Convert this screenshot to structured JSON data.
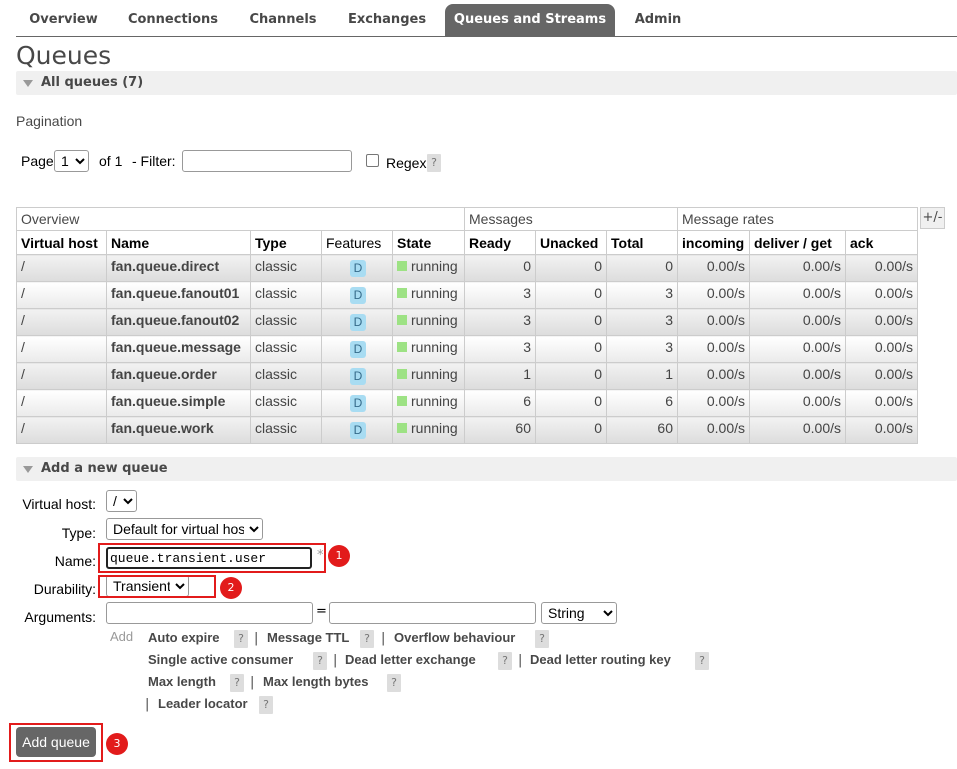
{
  "nav": {
    "tabs": [
      {
        "label": "Overview"
      },
      {
        "label": "Connections"
      },
      {
        "label": "Channels"
      },
      {
        "label": "Exchanges"
      },
      {
        "label": "Queues and Streams"
      },
      {
        "label": "Admin"
      }
    ],
    "active": "Queues and Streams"
  },
  "page_title": "Queues",
  "all_queues": {
    "header": "All queues (7)",
    "pagination_label": "Pagination",
    "page_label": "Page",
    "page_value": "1",
    "of_label": "of 1",
    "filter_label": "- Filter:",
    "filter_value": "",
    "regex_label": "Regex",
    "help": "?"
  },
  "table": {
    "group_headers": [
      "Overview",
      "Messages",
      "Message rates"
    ],
    "plus_minus": "+/-",
    "columns": [
      "Virtual host",
      "Name",
      "Type",
      "Features",
      "State",
      "Ready",
      "Unacked",
      "Total",
      "incoming",
      "deliver / get",
      "ack"
    ],
    "rows": [
      {
        "vhost": "/",
        "name": "fan.queue.direct",
        "type": "classic",
        "feature": "D",
        "state": "running",
        "ready": "0",
        "unacked": "0",
        "total": "0",
        "incoming": "0.00/s",
        "deliver": "0.00/s",
        "ack": "0.00/s"
      },
      {
        "vhost": "/",
        "name": "fan.queue.fanout01",
        "type": "classic",
        "feature": "D",
        "state": "running",
        "ready": "3",
        "unacked": "0",
        "total": "3",
        "incoming": "0.00/s",
        "deliver": "0.00/s",
        "ack": "0.00/s"
      },
      {
        "vhost": "/",
        "name": "fan.queue.fanout02",
        "type": "classic",
        "feature": "D",
        "state": "running",
        "ready": "3",
        "unacked": "0",
        "total": "3",
        "incoming": "0.00/s",
        "deliver": "0.00/s",
        "ack": "0.00/s"
      },
      {
        "vhost": "/",
        "name": "fan.queue.message",
        "type": "classic",
        "feature": "D",
        "state": "running",
        "ready": "3",
        "unacked": "0",
        "total": "3",
        "incoming": "0.00/s",
        "deliver": "0.00/s",
        "ack": "0.00/s"
      },
      {
        "vhost": "/",
        "name": "fan.queue.order",
        "type": "classic",
        "feature": "D",
        "state": "running",
        "ready": "1",
        "unacked": "0",
        "total": "1",
        "incoming": "0.00/s",
        "deliver": "0.00/s",
        "ack": "0.00/s"
      },
      {
        "vhost": "/",
        "name": "fan.queue.simple",
        "type": "classic",
        "feature": "D",
        "state": "running",
        "ready": "6",
        "unacked": "0",
        "total": "6",
        "incoming": "0.00/s",
        "deliver": "0.00/s",
        "ack": "0.00/s"
      },
      {
        "vhost": "/",
        "name": "fan.queue.work",
        "type": "classic",
        "feature": "D",
        "state": "running",
        "ready": "60",
        "unacked": "0",
        "total": "60",
        "incoming": "0.00/s",
        "deliver": "0.00/s",
        "ack": "0.00/s"
      }
    ]
  },
  "add_queue": {
    "header": "Add a new queue",
    "virtual_host_label": "Virtual host:",
    "virtual_host_value": "/",
    "type_label": "Type:",
    "type_value": "Default for virtual host",
    "name_label": "Name:",
    "name_value": "queue.transient.user",
    "required_mark": "*",
    "durability_label": "Durability:",
    "durability_value": "Transient",
    "arguments_label": "Arguments:",
    "equals": "=",
    "arg_type_value": "String",
    "add_label": "Add",
    "arg_links": [
      "Auto expire",
      "Message TTL",
      "Overflow behaviour",
      "Single active consumer",
      "Dead letter exchange",
      "Dead letter routing key",
      "Max length",
      "Max length bytes",
      "Leader locator"
    ],
    "separator": "|",
    "help": "?",
    "submit_label": "Add queue"
  },
  "annotations": {
    "badges": [
      "1",
      "2",
      "3"
    ],
    "highlight_color": "#e21b1b"
  }
}
